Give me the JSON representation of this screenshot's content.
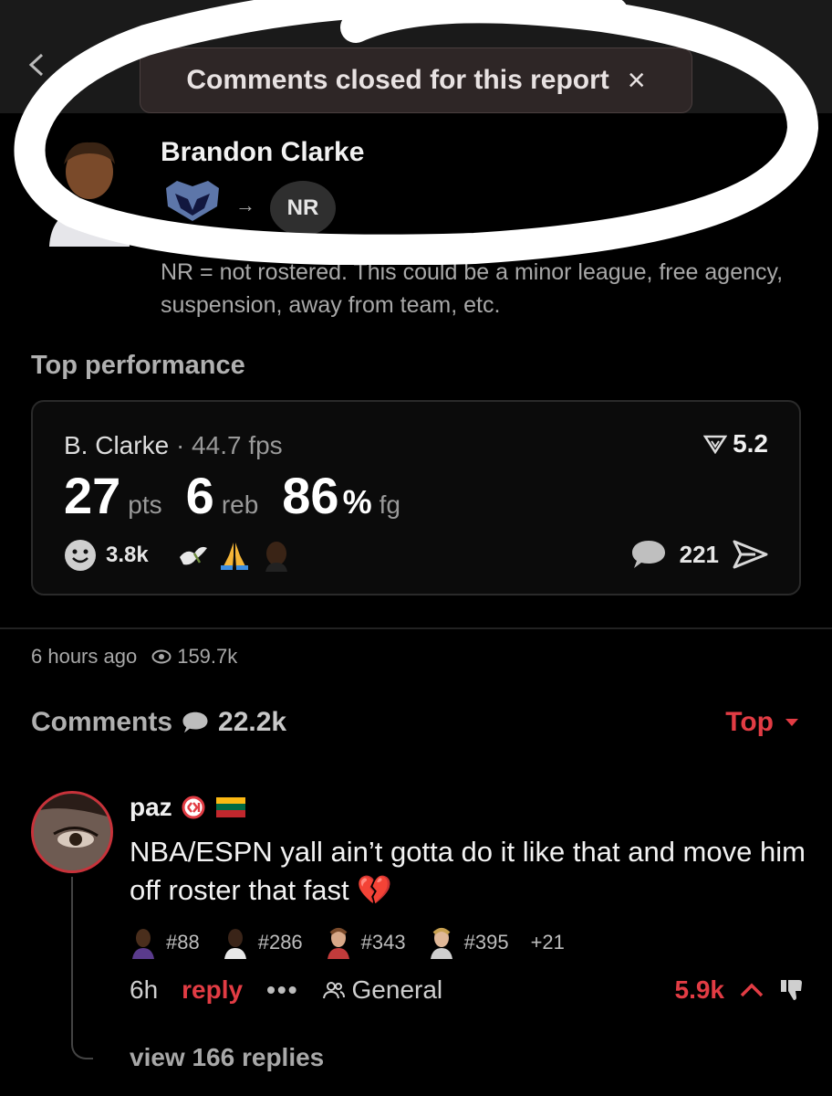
{
  "toast": {
    "text": "Comments closed for this report",
    "close": "×"
  },
  "player": {
    "name": "Brandon Clarke",
    "from_team_icon": "grizzlies-logo-icon",
    "arrow": "→",
    "to_team": "NR"
  },
  "note": "NR = not rostered. This could be a minor league, free agency, suspension, away from team, etc.",
  "top_performance": {
    "title": "Top performance",
    "player": "B. Clarke",
    "separator": "·",
    "fps": "44.7 fps",
    "rank": "5.2",
    "pts": "27",
    "pts_unit": "pts",
    "reb": "6",
    "reb_unit": "reb",
    "fg": "86",
    "fg_pct": "%",
    "fg_unit": "fg",
    "reactions": "3.8k",
    "comments": "221"
  },
  "meta": {
    "time": "6 hours ago",
    "views": "159.7k"
  },
  "comments": {
    "title": "Comments",
    "count": "22.2k",
    "sort": "Top"
  },
  "comment": {
    "user": "paz",
    "text": "NBA/ESPN yall ain’t gotta do it like that and move him off roster that fast",
    "emoji": "💔",
    "ranks": [
      "#88",
      "#286",
      "#343",
      "#395"
    ],
    "ranks_more": "+21",
    "time": "6h",
    "reply": "reply",
    "dots": "•••",
    "group": "General",
    "votes": "5.9k",
    "view_replies": "view 166 replies"
  },
  "colors": {
    "accent": "#e23c44",
    "background": "#000000",
    "card_border": "#2a2a2a"
  }
}
